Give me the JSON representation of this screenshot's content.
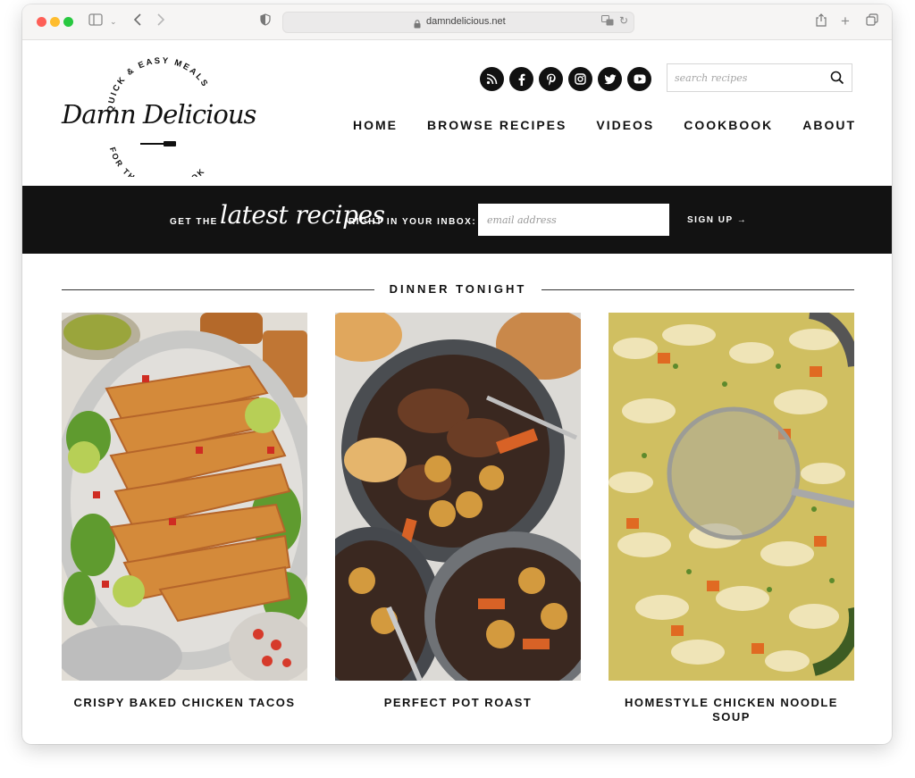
{
  "browser": {
    "url": "damndelicious.net"
  },
  "site": {
    "logo": {
      "top_text": "QUICK & EASY MEALS",
      "name": "Damn Delicious",
      "bottom_text": "FOR THE HOME COOK"
    },
    "social_icons": [
      "rss-icon",
      "facebook-icon",
      "pinterest-icon",
      "instagram-icon",
      "twitter-icon",
      "youtube-icon"
    ],
    "search": {
      "placeholder": "search recipes"
    },
    "nav": [
      "HOME",
      "BROWSE RECIPES",
      "VIDEOS",
      "COOKBOOK",
      "ABOUT"
    ]
  },
  "newsletter": {
    "prefix": "GET THE",
    "script": "latest recipes",
    "suffix": "RIGHT IN YOUR INBOX:",
    "email_placeholder": "email address",
    "signup_label": "SIGN UP →"
  },
  "section": {
    "title": "DINNER TONIGHT"
  },
  "recipes": [
    {
      "title": "CRISPY BAKED CHICKEN TACOS"
    },
    {
      "title": "PERFECT POT ROAST"
    },
    {
      "title": "HOMESTYLE CHICKEN NOODLE SOUP"
    }
  ],
  "colors": {
    "banner_bg": "#121212",
    "text": "#111111"
  }
}
